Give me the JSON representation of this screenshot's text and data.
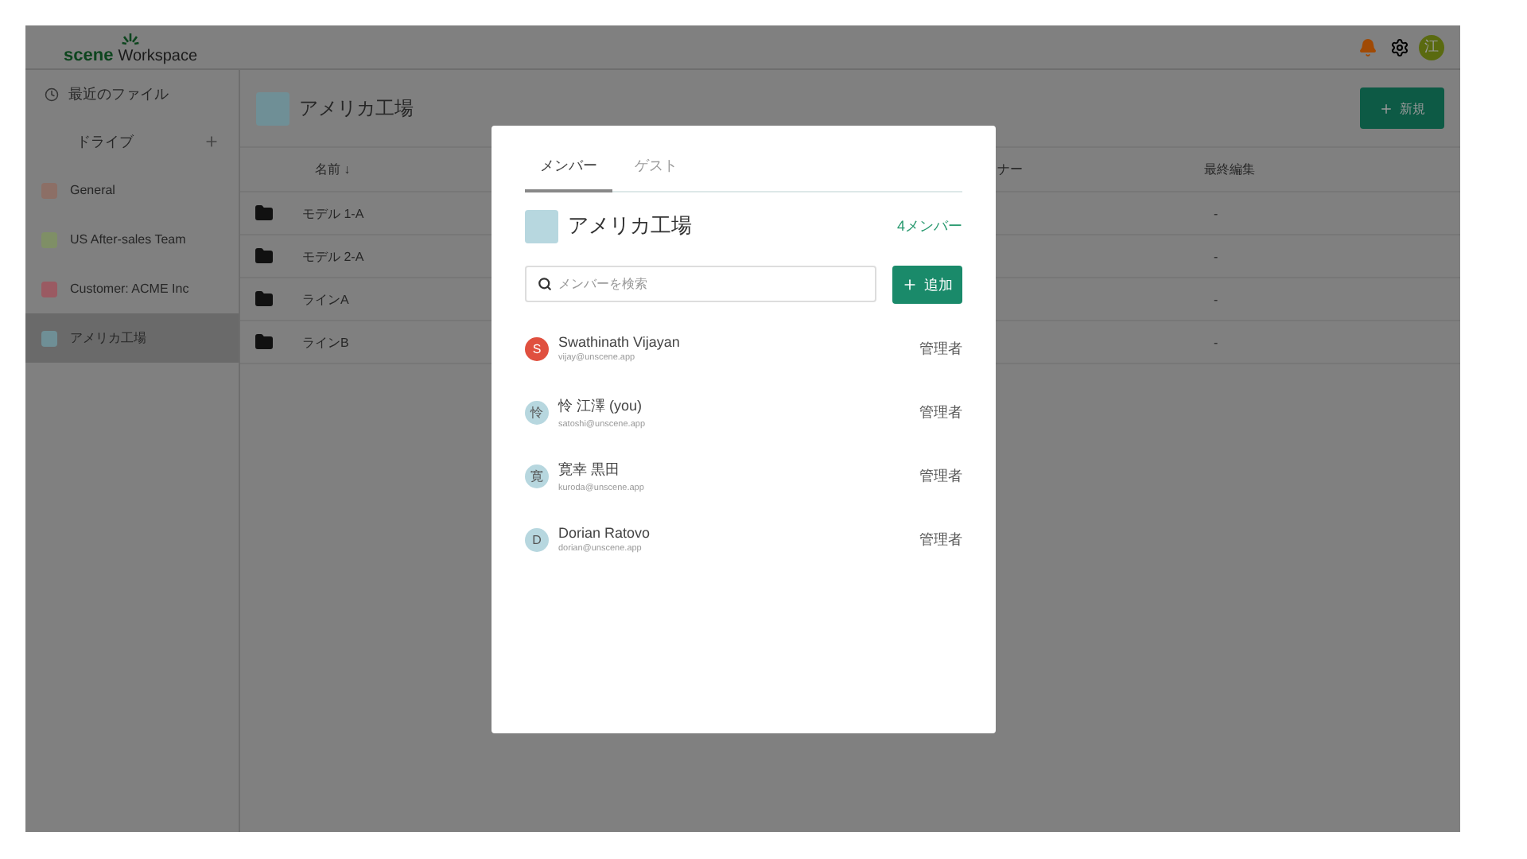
{
  "header": {
    "logo_brand": "scene",
    "logo_product": "Workspace",
    "avatar": "江"
  },
  "sidebar": {
    "recent": "最近のファイル",
    "drive": "ドライブ",
    "items": [
      {
        "label": "General",
        "color": "#8c6f66",
        "selected": false
      },
      {
        "label": "US After-sales Team",
        "color": "#7f8f66",
        "selected": false
      },
      {
        "label": "Customer: ACME Inc",
        "color": "#9a5a62",
        "selected": false
      },
      {
        "label": "アメリカ工場",
        "color": "#6f8f96",
        "selected": true
      }
    ]
  },
  "main": {
    "title": "アメリカ工場",
    "new_button": "新規",
    "table": {
      "columns": [
        "名前 ↓",
        "ナー",
        "最終編集"
      ],
      "rows": [
        {
          "name": "モデル 1-A",
          "last_edited": "-"
        },
        {
          "name": "モデル 2-A",
          "last_edited": "-"
        },
        {
          "name": "ラインA",
          "last_edited": "-"
        },
        {
          "name": "ラインB",
          "last_edited": "-"
        }
      ]
    }
  },
  "dialog": {
    "tabs": [
      {
        "label": "メンバー",
        "selected": true
      },
      {
        "label": "ゲスト",
        "selected": false
      }
    ],
    "title": "アメリカ工場",
    "member_count": "4メンバー",
    "search": {
      "placeholder": "メンバーを検索"
    },
    "add_button": "追加",
    "members": [
      {
        "initial": "S",
        "name": "Swathinath Vijayan",
        "email": "vijay@unscene.app",
        "role": "管理者",
        "color": "#e0503f"
      },
      {
        "initial": "怜",
        "name": "怜 江澤 (you)",
        "email": "satoshi@unscene.app",
        "role": "管理者",
        "color": "#b7d7df"
      },
      {
        "initial": "寛",
        "name": "寛幸 黒田",
        "email": "kuroda@unscene.app",
        "role": "管理者",
        "color": "#b7d7df"
      },
      {
        "initial": "D",
        "name": "Dorian Ratovo",
        "email": "dorian@unscene.app",
        "role": "管理者",
        "color": "#b7d7df"
      }
    ]
  }
}
